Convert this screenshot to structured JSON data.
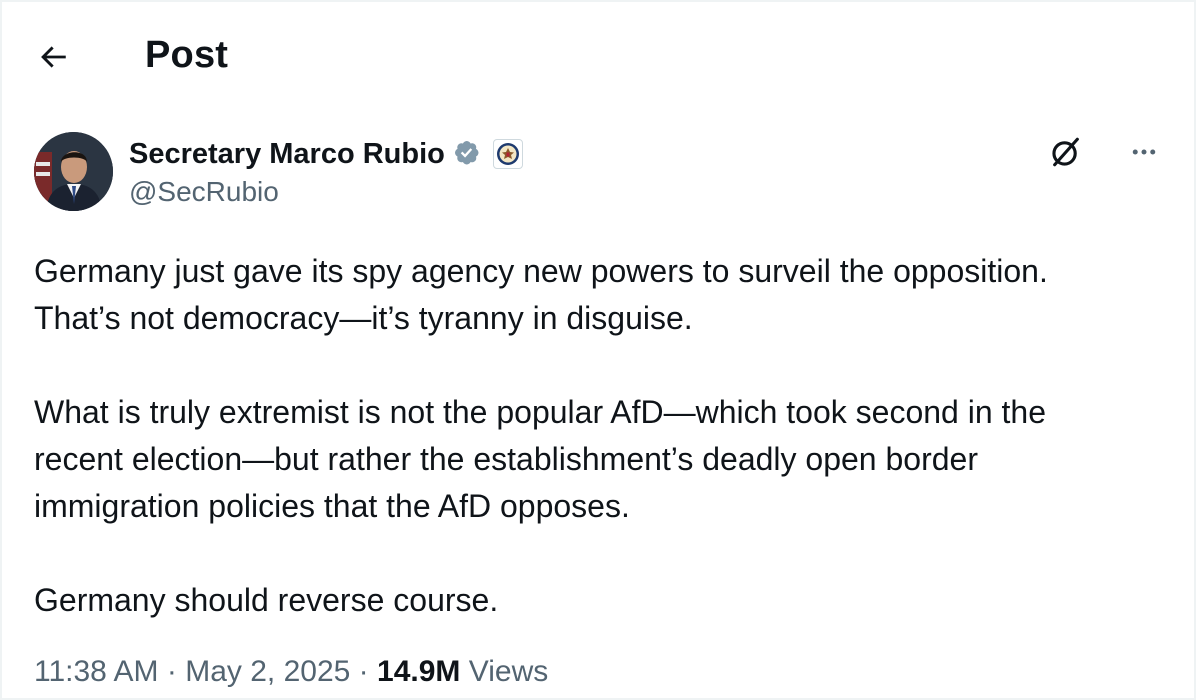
{
  "header": {
    "title": "Post",
    "back_icon": "arrow-left-icon"
  },
  "author": {
    "display_name": "Secretary Marco Rubio",
    "handle": "@SecRubio",
    "verified_icon": "verified-badge-icon",
    "affiliate_icon": "state-department-seal-icon",
    "verified_color": "#829aab"
  },
  "actions": {
    "grok_icon": "grok-icon",
    "more_icon": "more-horizontal-icon"
  },
  "tweet": {
    "line1": "Germany just gave its spy agency new powers to surveil the opposition.",
    "line2": "That’s not democracy—it’s tyranny in disguise.",
    "line3": "What is truly extremist is not the popular AfD—which took second in the",
    "line4": "recent election—but rather the establishment’s deadly open border",
    "line5": "immigration policies that the AfD opposes.",
    "line6": "Germany should reverse course."
  },
  "meta": {
    "time": "11:38 AM",
    "separator": "·",
    "date": "May 2, 2025",
    "views_count": "14.9M",
    "views_label": "Views"
  }
}
